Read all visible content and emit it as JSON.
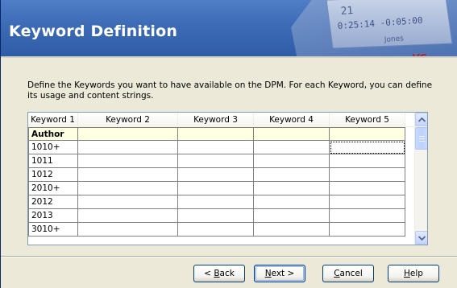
{
  "header": {
    "title": "Keyword Definition"
  },
  "description": "Define the Keywords you want to have available on the DPM. For each Keyword, you can define its usage and content strings.",
  "grid": {
    "columns": [
      "Keyword 1",
      "Keyword 2",
      "Keyword 3",
      "Keyword 4",
      "Keyword 5"
    ],
    "rows": [
      [
        "Author",
        "",
        "",
        "",
        ""
      ],
      [
        "1010+",
        "",
        "",
        "",
        ""
      ],
      [
        "1011",
        "",
        "",
        "",
        ""
      ],
      [
        "1012",
        "",
        "",
        "",
        ""
      ],
      [
        "2010+",
        "",
        "",
        "",
        ""
      ],
      [
        "2012",
        "",
        "",
        "",
        ""
      ],
      [
        "2013",
        "",
        "",
        "",
        ""
      ],
      [
        "3010+",
        "",
        "",
        "",
        ""
      ]
    ]
  },
  "scrollbar": {
    "up_icon": "scroll-up-arrow",
    "down_icon": "scroll-down-arrow"
  },
  "buttons": {
    "back_prefix": "< ",
    "back_mnemonic": "B",
    "back_rest": "ack",
    "next_mnemonic": "N",
    "next_rest": "ext >",
    "cancel_mnemonic": "C",
    "cancel_rest": "ancel",
    "help_mnemonic": "H",
    "help_rest": "elp"
  },
  "device_display": {
    "line1": "21",
    "line2": "0:25:14 -0:05:00",
    "line3": "Jones",
    "brand": "VC"
  },
  "colors": {
    "banner": "#3C6AB5",
    "dialog_bg": "#ECE9D8",
    "author_row_bg": "#FFFFE1"
  }
}
